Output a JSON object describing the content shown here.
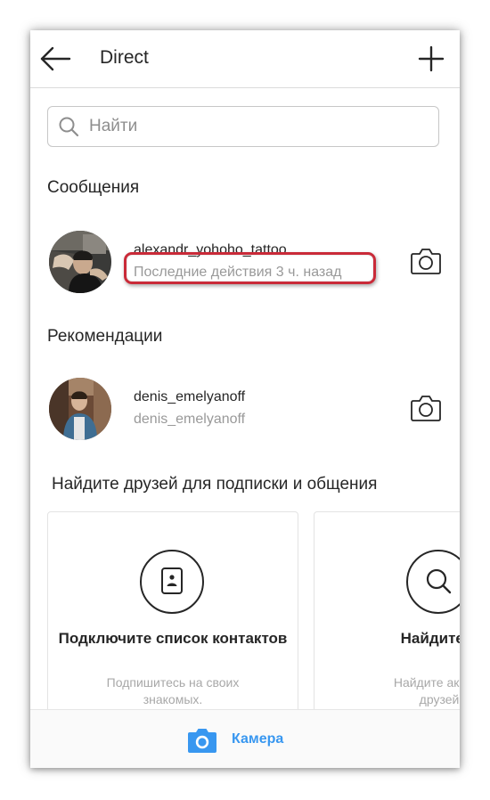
{
  "header": {
    "title": "Direct",
    "back_icon": "arrow-left-icon",
    "new_icon": "plus-icon"
  },
  "search": {
    "placeholder": "Найти",
    "icon": "search-icon"
  },
  "messages": {
    "heading": "Сообщения",
    "items": [
      {
        "username": "alexandr_yohoho_tattoo",
        "status": "Последние действия 3 ч. назад",
        "action_icon": "camera-outline-icon"
      }
    ]
  },
  "recommendations": {
    "heading": "Рекомендации",
    "items": [
      {
        "username": "denis_emelyanoff",
        "subtitle": "denis_emelyanoff",
        "action_icon": "camera-outline-icon"
      }
    ]
  },
  "find_friends": {
    "heading": "Найдите друзей для подписки и общения",
    "cards": [
      {
        "icon": "contact-card-icon",
        "title": "Подключите список контактов",
        "description": "Подпишитесь на своих знакомых."
      },
      {
        "icon": "search-icon",
        "title": "Найдите д",
        "description_line1": "Найдите аккаун",
        "description_line2": "друзей"
      }
    ]
  },
  "bottom_bar": {
    "label": "Камера",
    "icon": "camera-icon"
  },
  "colors": {
    "accent": "#3897f0",
    "highlight_border": "#c92a38",
    "text_primary": "#262626",
    "text_secondary": "#999999"
  }
}
